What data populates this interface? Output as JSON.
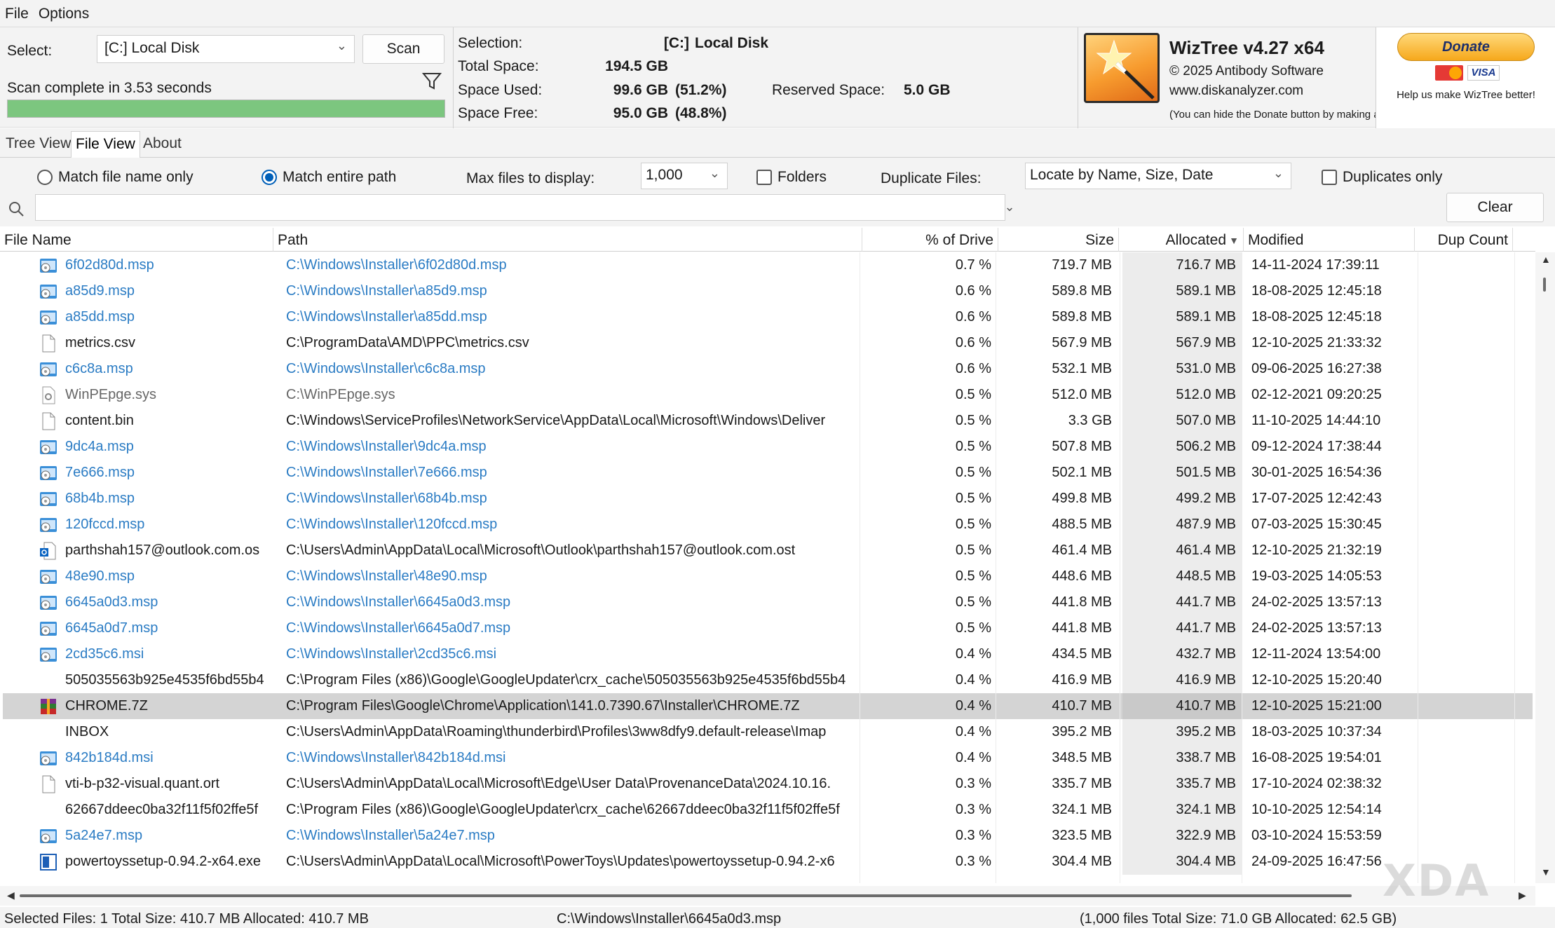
{
  "menu": [
    "File",
    "Options"
  ],
  "header": {
    "select_label": "Select:",
    "drive": "[C:] Local Disk",
    "scan_label": "Scan",
    "scan_status": "Scan complete in 3.53 seconds",
    "progress": 1.0
  },
  "stats": {
    "selection_label": "Selection:",
    "selection_drive": "[C:]",
    "selection_name": "Local Disk",
    "total_space_label": "Total Space:",
    "total_space": "194.5 GB",
    "space_used_label": "Space Used:",
    "space_used": "99.6 GB",
    "space_used_pct": "(51.2%)",
    "reserved_label": "Reserved Space:",
    "reserved": "5.0 GB",
    "space_free_label": "Space Free:",
    "space_free": "95.0 GB",
    "space_free_pct": "(48.8%)"
  },
  "app": {
    "title": "WizTree v4.27 x64",
    "copyright": "© 2025 Antibody Software",
    "url": "www.diskanalyzer.com",
    "note": "(You can hide the Donate button by making a donation)"
  },
  "donate": {
    "label": "Donate",
    "visa": "VISA",
    "help": "Help us make WizTree better!"
  },
  "tabs": [
    "Tree View",
    "File View",
    "About"
  ],
  "options": {
    "match_name": "Match file name only",
    "match_path": "Match entire path",
    "max_files_label": "Max files to display:",
    "max_files": "1,000",
    "folders": "Folders",
    "dup_label": "Duplicate Files:",
    "dup_mode": "Locate by Name, Size, Date",
    "dup_only": "Duplicates only",
    "search_value": "",
    "clear_label": "Clear"
  },
  "columns": {
    "name": "File Name",
    "path": "Path",
    "pct": "% of Drive",
    "size": "Size",
    "alloc": "Allocated",
    "modified": "Modified",
    "dup": "Dup Count"
  },
  "rows": [
    {
      "name": "6f02d80d.msp",
      "path": "C:\\Windows\\Installer\\6f02d80d.msp",
      "pct": "0.7 %",
      "size": "719.7 MB",
      "alloc": "716.7 MB",
      "mod": "14-11-2024 17:39:11",
      "type": "installer"
    },
    {
      "name": "a85d9.msp",
      "path": "C:\\Windows\\Installer\\a85d9.msp",
      "pct": "0.6 %",
      "size": "589.8 MB",
      "alloc": "589.1 MB",
      "mod": "18-08-2025 12:45:18",
      "type": "installer"
    },
    {
      "name": "a85dd.msp",
      "path": "C:\\Windows\\Installer\\a85dd.msp",
      "pct": "0.6 %",
      "size": "589.8 MB",
      "alloc": "589.1 MB",
      "mod": "18-08-2025 12:45:18",
      "type": "installer"
    },
    {
      "name": "metrics.csv",
      "path": "C:\\ProgramData\\AMD\\PPC\\metrics.csv",
      "pct": "0.6 %",
      "size": "567.9 MB",
      "alloc": "567.9 MB",
      "mod": "12-10-2025 21:33:32",
      "type": "doc"
    },
    {
      "name": "c6c8a.msp",
      "path": "C:\\Windows\\Installer\\c6c8a.msp",
      "pct": "0.6 %",
      "size": "532.1 MB",
      "alloc": "531.0 MB",
      "mod": "09-06-2025 16:27:38",
      "type": "installer"
    },
    {
      "name": "WinPEpge.sys",
      "path": "C:\\WinPEpge.sys",
      "pct": "0.5 %",
      "size": "512.0 MB",
      "alloc": "512.0 MB",
      "mod": "02-12-2021 09:20:25",
      "type": "sys"
    },
    {
      "name": "content.bin",
      "path": "C:\\Windows\\ServiceProfiles\\NetworkService\\AppData\\Local\\Microsoft\\Windows\\Deliver",
      "pct": "0.5 %",
      "size": "3.3 GB",
      "alloc": "507.0 MB",
      "mod": "11-10-2025 14:44:10",
      "type": "doc"
    },
    {
      "name": "9dc4a.msp",
      "path": "C:\\Windows\\Installer\\9dc4a.msp",
      "pct": "0.5 %",
      "size": "507.8 MB",
      "alloc": "506.2 MB",
      "mod": "09-12-2024 17:38:44",
      "type": "installer"
    },
    {
      "name": "7e666.msp",
      "path": "C:\\Windows\\Installer\\7e666.msp",
      "pct": "0.5 %",
      "size": "502.1 MB",
      "alloc": "501.5 MB",
      "mod": "30-01-2025 16:54:36",
      "type": "installer"
    },
    {
      "name": "68b4b.msp",
      "path": "C:\\Windows\\Installer\\68b4b.msp",
      "pct": "0.5 %",
      "size": "499.8 MB",
      "alloc": "499.2 MB",
      "mod": "17-07-2025 12:42:43",
      "type": "installer"
    },
    {
      "name": "120fccd.msp",
      "path": "C:\\Windows\\Installer\\120fccd.msp",
      "pct": "0.5 %",
      "size": "488.5 MB",
      "alloc": "487.9 MB",
      "mod": "07-03-2025 15:30:45",
      "type": "installer"
    },
    {
      "name": "parthshah157@outlook.com.os",
      "path": "C:\\Users\\Admin\\AppData\\Local\\Microsoft\\Outlook\\parthshah157@outlook.com.ost",
      "pct": "0.5 %",
      "size": "461.4 MB",
      "alloc": "461.4 MB",
      "mod": "12-10-2025 21:32:19",
      "type": "outlook"
    },
    {
      "name": "48e90.msp",
      "path": "C:\\Windows\\Installer\\48e90.msp",
      "pct": "0.5 %",
      "size": "448.6 MB",
      "alloc": "448.5 MB",
      "mod": "19-03-2025 14:05:53",
      "type": "installer"
    },
    {
      "name": "6645a0d3.msp",
      "path": "C:\\Windows\\Installer\\6645a0d3.msp",
      "pct": "0.5 %",
      "size": "441.8 MB",
      "alloc": "441.7 MB",
      "mod": "24-02-2025 13:57:13",
      "type": "installer"
    },
    {
      "name": "6645a0d7.msp",
      "path": "C:\\Windows\\Installer\\6645a0d7.msp",
      "pct": "0.5 %",
      "size": "441.8 MB",
      "alloc": "441.7 MB",
      "mod": "24-02-2025 13:57:13",
      "type": "installer"
    },
    {
      "name": "2cd35c6.msi",
      "path": "C:\\Windows\\Installer\\2cd35c6.msi",
      "pct": "0.4 %",
      "size": "434.5 MB",
      "alloc": "432.7 MB",
      "mod": "12-11-2024 13:54:00",
      "type": "installer"
    },
    {
      "name": "505035563b925e4535f6bd55b4",
      "path": "C:\\Program Files (x86)\\Google\\GoogleUpdater\\crx_cache\\505035563b925e4535f6bd55b4",
      "pct": "0.4 %",
      "size": "416.9 MB",
      "alloc": "416.9 MB",
      "mod": "12-10-2025 15:20:40",
      "type": "none"
    },
    {
      "name": "CHROME.7Z",
      "path": "C:\\Program Files\\Google\\Chrome\\Application\\141.0.7390.67\\Installer\\CHROME.7Z",
      "pct": "0.4 %",
      "size": "410.7 MB",
      "alloc": "410.7 MB",
      "mod": "12-10-2025 15:21:00",
      "type": "archive",
      "selected": true
    },
    {
      "name": "INBOX",
      "path": "C:\\Users\\Admin\\AppData\\Roaming\\thunderbird\\Profiles\\3ww8dfy9.default-release\\Imap",
      "pct": "0.4 %",
      "size": "395.2 MB",
      "alloc": "395.2 MB",
      "mod": "18-03-2025 10:37:34",
      "type": "none"
    },
    {
      "name": "842b184d.msi",
      "path": "C:\\Windows\\Installer\\842b184d.msi",
      "pct": "0.4 %",
      "size": "348.5 MB",
      "alloc": "338.7 MB",
      "mod": "16-08-2025 19:54:01",
      "type": "installer"
    },
    {
      "name": "vti-b-p32-visual.quant.ort",
      "path": "C:\\Users\\Admin\\AppData\\Local\\Microsoft\\Edge\\User Data\\ProvenanceData\\2024.10.16.",
      "pct": "0.3 %",
      "size": "335.7 MB",
      "alloc": "335.7 MB",
      "mod": "17-10-2024 02:38:32",
      "type": "doc"
    },
    {
      "name": "62667ddeec0ba32f11f5f02ffe5f",
      "path": "C:\\Program Files (x86)\\Google\\GoogleUpdater\\crx_cache\\62667ddeec0ba32f11f5f02ffe5f",
      "pct": "0.3 %",
      "size": "324.1 MB",
      "alloc": "324.1 MB",
      "mod": "10-10-2025 12:54:14",
      "type": "none"
    },
    {
      "name": "5a24e7.msp",
      "path": "C:\\Windows\\Installer\\5a24e7.msp",
      "pct": "0.3 %",
      "size": "323.5 MB",
      "alloc": "322.9 MB",
      "mod": "03-10-2024 15:53:59",
      "type": "installer"
    },
    {
      "name": "powertoyssetup-0.94.2-x64.exe",
      "path": "C:\\Users\\Admin\\AppData\\Local\\Microsoft\\PowerToys\\Updates\\powertoyssetup-0.94.2-x6",
      "pct": "0.3 %",
      "size": "304.4 MB",
      "alloc": "304.4 MB",
      "mod": "24-09-2025 16:47:56",
      "type": "exe"
    }
  ],
  "status": {
    "selected": "Selected Files: 1  Total Size: 410.7 MB  Allocated: 410.7 MB",
    "path": "C:\\Windows\\Installer\\6645a0d3.msp",
    "summary": "(1,000 files  Total Size: 71.0 GB  Allocated: 62.5 GB)"
  },
  "colors": {
    "accent": "#005fb8",
    "installer_text": "#2b7cc4",
    "progress_fill": "#7cc67f",
    "selected_row": "#d4d4d4"
  }
}
